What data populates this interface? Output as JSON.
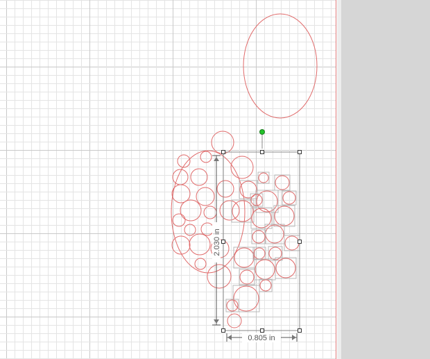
{
  "canvas": {
    "background_color": "#ffffff",
    "minor_grid_color": "#e4e4e4",
    "major_grid_color": "#c9c9c9",
    "page_edge_color": "#e07a7a",
    "outside_area_color": "#d6d6d6"
  },
  "shapes": {
    "stroke_color": "#e06a6a",
    "bounding_box_color": "#b8b8b8"
  },
  "selection": {
    "handle_color": "#333333",
    "rotate_handle_color": "#22c22a",
    "height_label": "2.030 in",
    "width_label": "0.805 in"
  }
}
